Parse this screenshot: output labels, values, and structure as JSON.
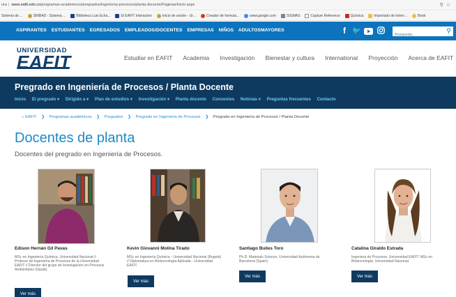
{
  "browser": {
    "url_prefix": "ura",
    "url_domain": "www.eafit.edu.co",
    "url_path": "/programas-academicos/pregrados/ingenieria-procesos/planta-docente/Paginas/inicio.aspx",
    "bookmarks": [
      "Sistema de ...",
      "SINBAD - Sistema ...",
      "Biblioteca Luis Echa...",
      "El EAFIT Interactivo",
      "Inicio de sesión - Ur...",
      "Creador de formula...",
      "www.google.com",
      "SIGMAS",
      "Capture Reference",
      "Química",
      "Importado de Intern...",
      "Book"
    ]
  },
  "topnav": {
    "links": [
      "ASPIRANTES",
      "ESTUDIANTES",
      "EGRESADOS",
      "EMPLEADOS/DOCENTES",
      "EMPRESAS",
      "NIÑOS",
      "ADULTOSMAYORES"
    ],
    "search_placeholder": "Búsqueda..."
  },
  "logo": {
    "line1": "UNIVERSIDAD",
    "line2": "EAFIT"
  },
  "mainnav": [
    "Estudiar en EAFIT",
    "Academia",
    "Investigación",
    "Bienestar y cultura",
    "International",
    "Proyección",
    "Acerca de EAFIT"
  ],
  "banner": {
    "title": "Pregrado en Ingeniería de Procesos / Planta Docente",
    "subnav": [
      "Inicio",
      "El pregrado ▾",
      "Dirigido a ▾",
      "Plan de estudios ▾",
      "Investigación ▾",
      "Planta docente",
      "Convenios",
      "Noticias ▾",
      "Preguntas frecuentes",
      "Contacto"
    ]
  },
  "breadcrumb": {
    "items": [
      "EAFIT",
      "Programas académicos",
      "Pregrados",
      "Pregrado en Ingeniería de Procesos",
      "Pregrado en Ingeniería de Procesos / Planta Docente"
    ]
  },
  "heading": "Docentes de planta",
  "subheading": "Docentes del pregrado en Ingeniería de Procesos.",
  "button_label": "Ver más",
  "professors": [
    {
      "name": "Edison Hernán Gil Pavas",
      "description": "MSc en Ingeniería Química. Universidad Nacional // Profesor de Ingeniería de Procesos de la Universidad EAFIT // Director del grupo de Investigación en Procesos Ambientales (Gipab)."
    },
    {
      "name": "Kevin Giovanni Molina Tirado",
      "description": "MSc en Ingeniería Química - Universidad Nacional (Bogotá) // Diplomatura en Biotecnología Aplicada - Universidad EAFIT."
    },
    {
      "name": "Santiago Builes Toro",
      "description": "Ph.D. Materials Science, Universidad Autónoma de Barcelona (Spain)."
    },
    {
      "name": "Catalina Giraldo Estrada",
      "description": "Ingeniera de Procesos. Universidad EAFIT. MSc en Biotecnología. Universidad Nacional."
    }
  ],
  "colors": {
    "top_blue": "#0b74bc",
    "banner_navy": "#0f3a5f",
    "link_cyan": "#6dc9f3",
    "heading_blue": "#1f88c8"
  }
}
